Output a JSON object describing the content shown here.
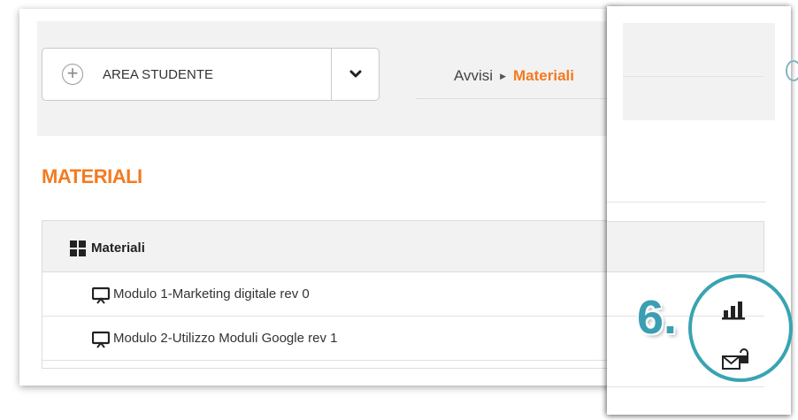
{
  "area_dropdown": {
    "label": "AREA STUDENTE",
    "plus_icon": "plus-circle-icon",
    "chevron_icon": "chevron-down-icon"
  },
  "breadcrumb": {
    "items": [
      "Avvisi",
      "Materiali"
    ],
    "separator_icon": "caret-right-icon",
    "active_color": "#f47a20"
  },
  "page": {
    "title": "MATERIALI",
    "accent_color": "#f47a20"
  },
  "table": {
    "header": "Materiali",
    "header_icon": "grid-icon",
    "rows": [
      {
        "title": "Modulo 1-Marketing digitale rev 0",
        "icon": "presentation-icon"
      },
      {
        "title": "Modulo 2-Utilizzo Moduli Google rev 1",
        "icon": "presentation-icon"
      }
    ]
  },
  "callout": {
    "step_label": "6.",
    "color": "#3a9fb3",
    "icons": [
      "bar-chart-icon",
      "mail-lock-icon"
    ]
  }
}
